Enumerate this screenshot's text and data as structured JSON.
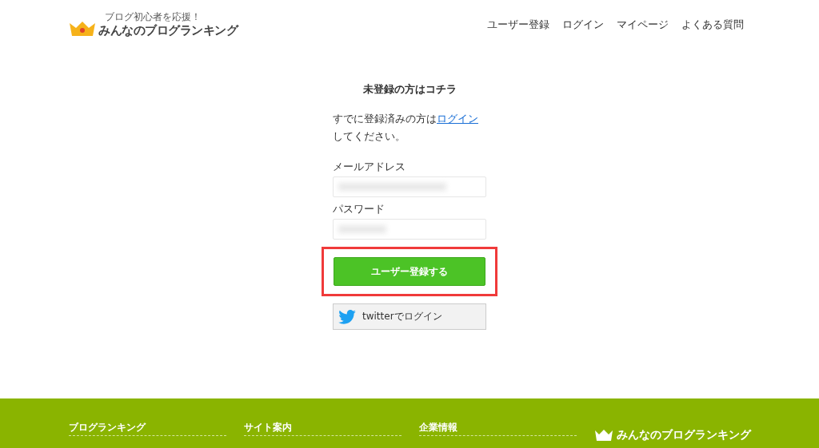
{
  "header": {
    "logo_tagline": "ブログ初心者を応援！",
    "logo_text": "みんなのブログランキング",
    "nav": [
      "ユーザー登録",
      "ログイン",
      "マイページ",
      "よくある質問"
    ]
  },
  "form": {
    "title": "未登録の方はコチラ",
    "intro_before": "すでに登録済みの方は",
    "intro_link": "ログイン",
    "intro_after": "してください。",
    "fields": [
      {
        "label": "メールアドレス",
        "kind": "text"
      },
      {
        "label": "パスワード",
        "kind": "password"
      }
    ],
    "submit": "ユーザー登録する",
    "submit_highlighted": true,
    "twitter": "twitterでログイン"
  },
  "footer": {
    "columns": [
      "ブログランキング",
      "サイト案内",
      "企業情報"
    ],
    "logo_text": "みんなのブログランキング"
  }
}
